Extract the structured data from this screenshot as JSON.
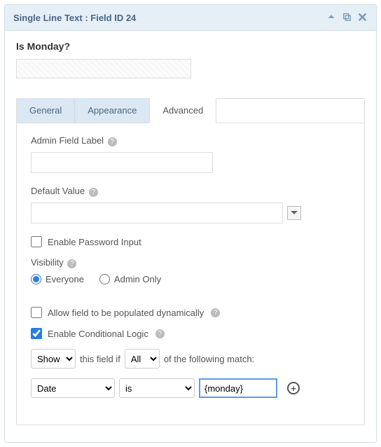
{
  "header": {
    "title": "Single Line Text : Field ID 24"
  },
  "field": {
    "label": "Is Monday?"
  },
  "tabs": {
    "general": "General",
    "appearance": "Appearance",
    "advanced": "Advanced"
  },
  "advanced": {
    "admin_label_label": "Admin Field Label",
    "admin_label_value": "",
    "default_value_label": "Default Value",
    "default_value": "",
    "password_label": "Enable Password Input",
    "password_checked": false,
    "visibility_label": "Visibility",
    "visibility_options": {
      "everyone": "Everyone",
      "admin": "Admin Only"
    },
    "visibility_value": "everyone",
    "dynamic_label": "Allow field to be populated dynamically",
    "dynamic_checked": false,
    "conditional_label": "Enable Conditional Logic",
    "conditional_checked": true,
    "logic": {
      "action": "Show",
      "text_mid": "this field if",
      "match": "All",
      "text_end": "of the following match:",
      "rule": {
        "field": "Date",
        "operator": "is",
        "value": "{monday}"
      }
    }
  }
}
